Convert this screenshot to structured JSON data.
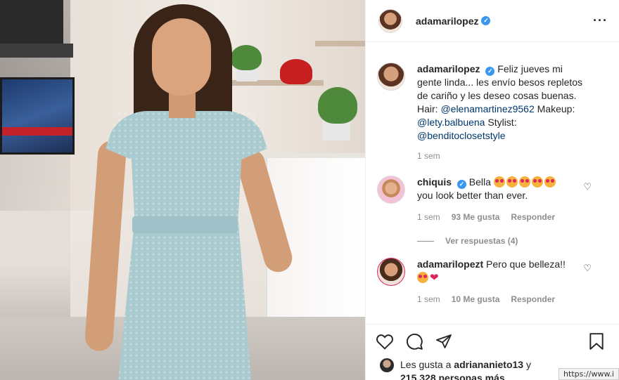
{
  "post": {
    "author": "adamarilopez",
    "verified": true
  },
  "caption": {
    "author": "adamarilopez",
    "text_1": "Feliz jueves mi gente linda... les envío besos repletos de cariño y les deseo cosas buenas. Hair: ",
    "mention_1": "@elenamartinez9562",
    "text_2": " Makeup: ",
    "mention_2": "@lety.balbuena",
    "text_3": " Stylist: ",
    "mention_3": "@benditoclosetstyle",
    "time": "1 sem"
  },
  "comments": [
    {
      "author": "chiquis",
      "verified": true,
      "text": "Bella",
      "emoji_count": 5,
      "text_2": "you look better than ever.",
      "time": "1 sem",
      "likes": "93 Me gusta",
      "reply": "Responder",
      "view_replies": "Ver respuestas (4)"
    },
    {
      "author": "adamarilopezt",
      "verified": false,
      "text": "Pero que belleza!!",
      "time": "1 sem",
      "likes": "10 Me gusta",
      "reply": "Responder"
    }
  ],
  "likes": {
    "prefix": "Les gusta a ",
    "user": "adriananieto13",
    "middle": " y",
    "count": "215.328 personas más"
  },
  "statusbar": "https://www.i",
  "icons": [
    "more-icon",
    "heart-icon",
    "comment-icon",
    "share-icon",
    "bookmark-icon",
    "verified-icon"
  ],
  "colors": {
    "verified": "#3897f0",
    "mention": "#00376b",
    "muted": "#8e8e8e"
  }
}
